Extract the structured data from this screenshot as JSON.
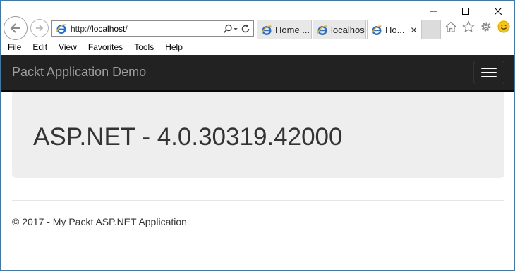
{
  "browser": {
    "address": {
      "scheme": "http://",
      "host": "localhost",
      "path": "/"
    },
    "tabs": [
      {
        "label": "Home ...",
        "active": false
      },
      {
        "label": "localhost",
        "active": false
      },
      {
        "label": "Ho...",
        "active": true
      }
    ],
    "menu": [
      "File",
      "Edit",
      "View",
      "Favorites",
      "Tools",
      "Help"
    ],
    "icons": {
      "back": "back-arrow-icon",
      "forward": "forward-arrow-icon",
      "search": "search-icon",
      "refresh": "refresh-icon",
      "home": "home-icon",
      "favorites": "star-icon",
      "settings": "gear-icon",
      "feedback": "smiley-icon"
    }
  },
  "page": {
    "brand": "Packt Application Demo",
    "heading": "ASP.NET - 4.0.30319.42000",
    "footer": "© 2017 - My Packt ASP.NET Application"
  },
  "colors": {
    "window_border": "#1883d7",
    "navbar": "#222222",
    "brand_text": "#9d9d9d",
    "jumbotron": "#eeeeee",
    "ie_blue": "#1f6fd6",
    "ie_gold": "#f2b01e"
  }
}
